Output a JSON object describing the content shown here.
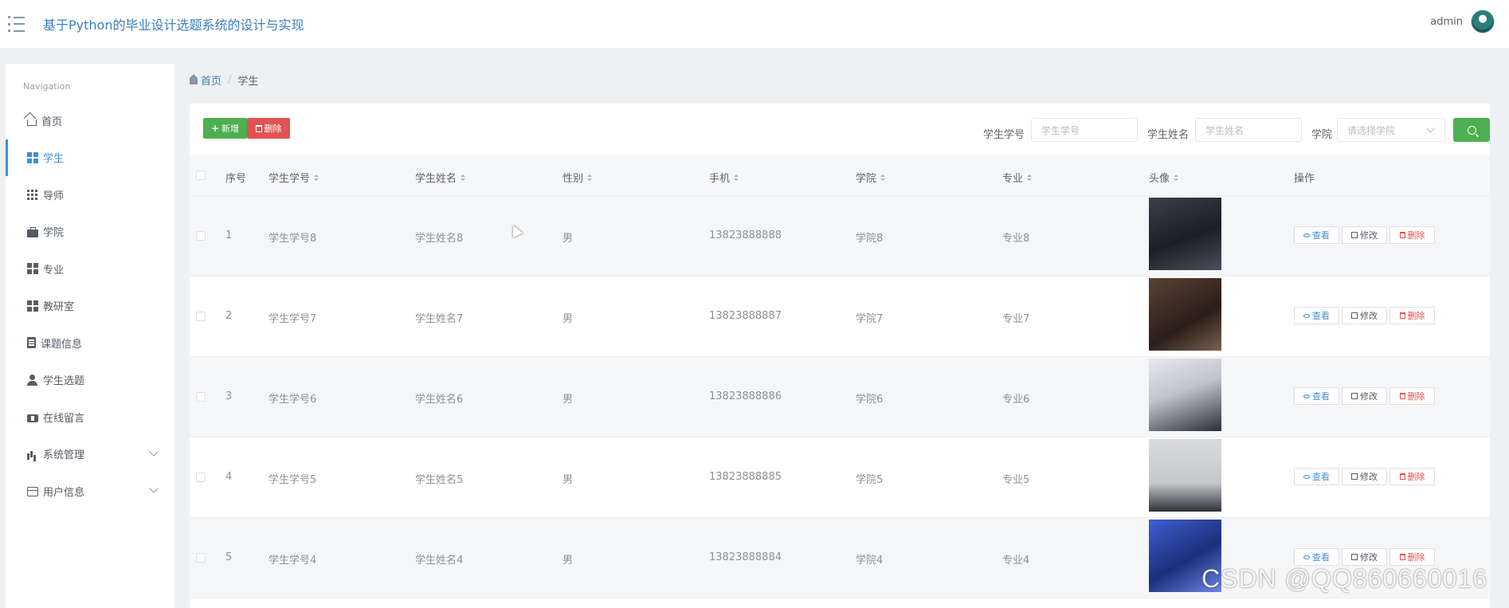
{
  "header": {
    "title": "基于Python的毕业设计选题系统的设计与实现",
    "username": "admin"
  },
  "sidebar": {
    "heading": "Navigation",
    "items": [
      {
        "label": "首页",
        "icon": "home-icon"
      },
      {
        "label": "学生",
        "icon": "grid-icon"
      },
      {
        "label": "导师",
        "icon": "table-icon"
      },
      {
        "label": "学院",
        "icon": "briefcase-icon"
      },
      {
        "label": "专业",
        "icon": "grid-icon"
      },
      {
        "label": "教研室",
        "icon": "grid-icon"
      },
      {
        "label": "课题信息",
        "icon": "clipboard-icon"
      },
      {
        "label": "学生选题",
        "icon": "user-icon"
      },
      {
        "label": "在线留言",
        "icon": "ticket-icon"
      },
      {
        "label": "系统管理",
        "icon": "bar-chart-icon"
      },
      {
        "label": "用户信息",
        "icon": "id-card-icon"
      }
    ]
  },
  "breadcrumb": {
    "home": "首页",
    "separator": "/",
    "current": "学生"
  },
  "toolbar": {
    "add_label": "新增",
    "delete_label": "删除"
  },
  "filters": {
    "student_no_label": "学生学号",
    "student_no_placeholder": "学生学号",
    "student_name_label": "学生姓名",
    "student_name_placeholder": "学生姓名",
    "college_label": "学院",
    "college_placeholder": "请选择学院"
  },
  "table": {
    "columns": [
      "序号",
      "学生学号",
      "学生姓名",
      "性别",
      "手机",
      "学院",
      "专业",
      "头像",
      "操作"
    ],
    "rows": [
      {
        "index": "1",
        "student_no": "学生学号8",
        "student_name": "学生姓名8",
        "gender": "男",
        "phone": "13823888888",
        "college": "学院8",
        "major": "专业8"
      },
      {
        "index": "2",
        "student_no": "学生学号7",
        "student_name": "学生姓名7",
        "gender": "男",
        "phone": "13823888887",
        "college": "学院7",
        "major": "专业7"
      },
      {
        "index": "3",
        "student_no": "学生学号6",
        "student_name": "学生姓名6",
        "gender": "男",
        "phone": "13823888886",
        "college": "学院6",
        "major": "专业6"
      },
      {
        "index": "4",
        "student_no": "学生学号5",
        "student_name": "学生姓名5",
        "gender": "男",
        "phone": "13823888885",
        "college": "学院5",
        "major": "专业5"
      },
      {
        "index": "5",
        "student_no": "学生学号4",
        "student_name": "学生姓名4",
        "gender": "男",
        "phone": "13823888884",
        "college": "学院4",
        "major": "专业4"
      }
    ],
    "actions": {
      "view": "查看",
      "edit": "修改",
      "delete": "删除"
    }
  },
  "watermark": "CSDN @QQ860660016",
  "colors": {
    "accent": "#3f8fd6",
    "title": "#3b7fbd",
    "add": "#4caf50",
    "delete": "#e05353"
  }
}
